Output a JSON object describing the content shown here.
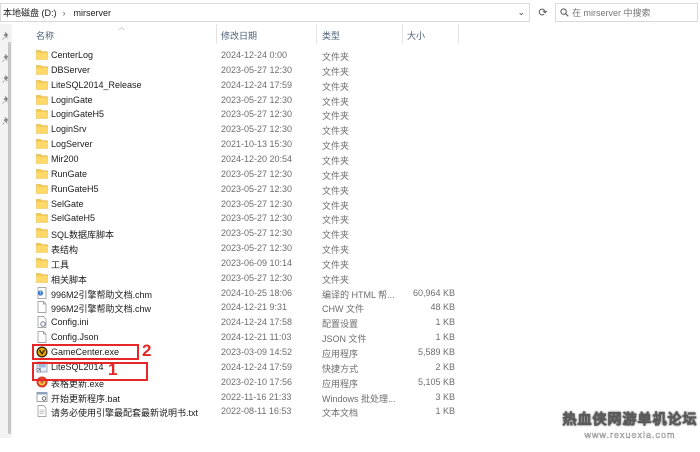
{
  "address": {
    "crumbs": [
      "本地磁盘 (D:)",
      "mirserver"
    ],
    "refresh_glyph": "⟳"
  },
  "search": {
    "placeholder": "在 mirserver 中搜索"
  },
  "columns": {
    "name": "名称",
    "date": "修改日期",
    "type": "类型",
    "size": "大小"
  },
  "files": [
    {
      "name": "CenterLog",
      "date": "2024-12-24 0:00",
      "type": "文件夹",
      "size": "",
      "icon": "folder-icon"
    },
    {
      "name": "DBServer",
      "date": "2023-05-27 12:30",
      "type": "文件夹",
      "size": "",
      "icon": "folder-icon"
    },
    {
      "name": "LiteSQL2014_Release",
      "date": "2024-12-24 17:59",
      "type": "文件夹",
      "size": "",
      "icon": "folder-icon"
    },
    {
      "name": "LoginGate",
      "date": "2023-05-27 12:30",
      "type": "文件夹",
      "size": "",
      "icon": "folder-icon"
    },
    {
      "name": "LoginGateH5",
      "date": "2023-05-27 12:30",
      "type": "文件夹",
      "size": "",
      "icon": "folder-icon"
    },
    {
      "name": "LoginSrv",
      "date": "2023-05-27 12:30",
      "type": "文件夹",
      "size": "",
      "icon": "folder-icon"
    },
    {
      "name": "LogServer",
      "date": "2021-10-13 15:30",
      "type": "文件夹",
      "size": "",
      "icon": "folder-icon"
    },
    {
      "name": "Mir200",
      "date": "2024-12-20 20:54",
      "type": "文件夹",
      "size": "",
      "icon": "folder-icon"
    },
    {
      "name": "RunGate",
      "date": "2023-05-27 12:30",
      "type": "文件夹",
      "size": "",
      "icon": "folder-icon"
    },
    {
      "name": "RunGateH5",
      "date": "2023-05-27 12:30",
      "type": "文件夹",
      "size": "",
      "icon": "folder-icon"
    },
    {
      "name": "SelGate",
      "date": "2023-05-27 12:30",
      "type": "文件夹",
      "size": "",
      "icon": "folder-icon"
    },
    {
      "name": "SelGateH5",
      "date": "2023-05-27 12:30",
      "type": "文件夹",
      "size": "",
      "icon": "folder-icon"
    },
    {
      "name": "SQL数据库脚本",
      "date": "2023-05-27 12:30",
      "type": "文件夹",
      "size": "",
      "icon": "folder-icon"
    },
    {
      "name": "表结构",
      "date": "2023-05-27 12:30",
      "type": "文件夹",
      "size": "",
      "icon": "folder-icon"
    },
    {
      "name": "工具",
      "date": "2023-06-09 10:14",
      "type": "文件夹",
      "size": "",
      "icon": "folder-icon"
    },
    {
      "name": "相关脚本",
      "date": "2023-05-27 12:30",
      "type": "文件夹",
      "size": "",
      "icon": "folder-icon"
    },
    {
      "name": "996M2引擎帮助文档.chm",
      "date": "2024-10-25 18:06",
      "type": "编译的 HTML 帮...",
      "size": "60,964 KB",
      "icon": "chm-file-icon"
    },
    {
      "name": "996M2引擎帮助文档.chw",
      "date": "2024-12-21 9:31",
      "type": "CHW 文件",
      "size": "48 KB",
      "icon": "document-file-icon"
    },
    {
      "name": "Config.ini",
      "date": "2024-12-24 17:58",
      "type": "配置设置",
      "size": "1 KB",
      "icon": "settings-file-icon"
    },
    {
      "name": "Config.Json",
      "date": "2024-12-21 11:03",
      "type": "JSON 文件",
      "size": "1 KB",
      "icon": "document-file-icon"
    },
    {
      "name": "GameCenter.exe",
      "date": "2023-03-09 14:52",
      "type": "应用程序",
      "size": "5,589 KB",
      "icon": "gamecenter-app-icon"
    },
    {
      "name": "LiteSQL2014",
      "date": "2024-12-24 17:59",
      "type": "快捷方式",
      "size": "2 KB",
      "icon": "shortcut-icon"
    },
    {
      "name": "表格更新.exe",
      "date": "2023-02-10 17:56",
      "type": "应用程序",
      "size": "5,105 KB",
      "icon": "updater-app-icon"
    },
    {
      "name": "开始更新程序.bat",
      "date": "2022-11-16 21:33",
      "type": "Windows 批处理...",
      "size": "3 KB",
      "icon": "batch-file-icon"
    },
    {
      "name": "请务必使用引擎最配套最新说明书.txt",
      "date": "2022-08-11 16:53",
      "type": "文本文档",
      "size": "1 KB",
      "icon": "text-file-icon"
    }
  ],
  "annotations": {
    "label_1": "1",
    "label_2": "2"
  },
  "watermark": {
    "title": "热血侠网游单机论坛",
    "url": "www.rexuexia.com"
  },
  "colors": {
    "folder": "#f2c84b",
    "annotation": "#e52727",
    "header_text": "#4c607a"
  }
}
